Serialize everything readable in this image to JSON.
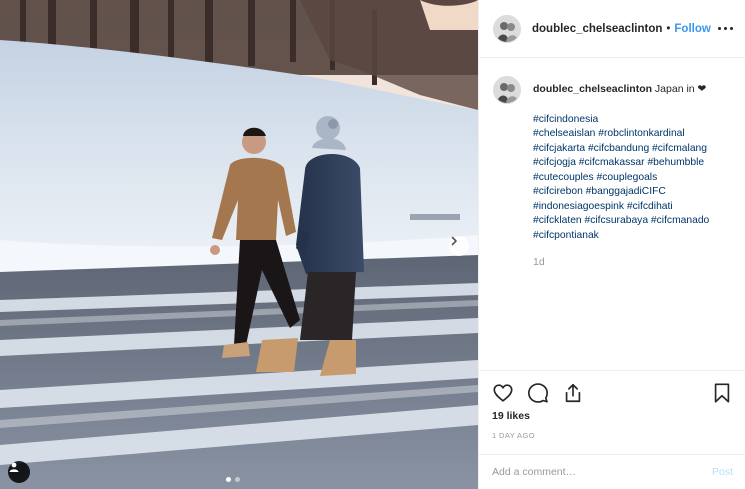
{
  "post": {
    "author": "doublec_chelseaclinton",
    "follow_separator": "•",
    "follow_label": "Follow",
    "more_icon": "more-options-icon"
  },
  "caption": {
    "username": "doublec_chelseaclinton",
    "text": "Japan in ❤",
    "hashtag_lines": [
      "#cifcindonesia",
      "#chelseaislan #robclintonkardinal",
      "#cifcjakarta #cifcbandung #cifcmalang",
      "#cifcjogja #cifcmakassar #behumbble",
      "#cutecouples #couplegoals",
      "#cifcirebon #banggajadiCIFC",
      "#indonesiagoespink #cifcdihati",
      "#cifcklaten #cifcsurabaya #cifcmanado",
      "#cifcpontianak"
    ],
    "posted_ago": "1d"
  },
  "actions": {
    "likes": "19 likes",
    "timestamp": "1 DAY AGO"
  },
  "comment_box": {
    "placeholder": "Add a comment…",
    "post_label": "Post"
  },
  "carousel": {
    "current": 1,
    "total": 2
  },
  "colors": {
    "link_blue": "#3897f0",
    "hashtag_blue": "#003569",
    "muted_gray": "#999999",
    "divider": "#efefef"
  }
}
